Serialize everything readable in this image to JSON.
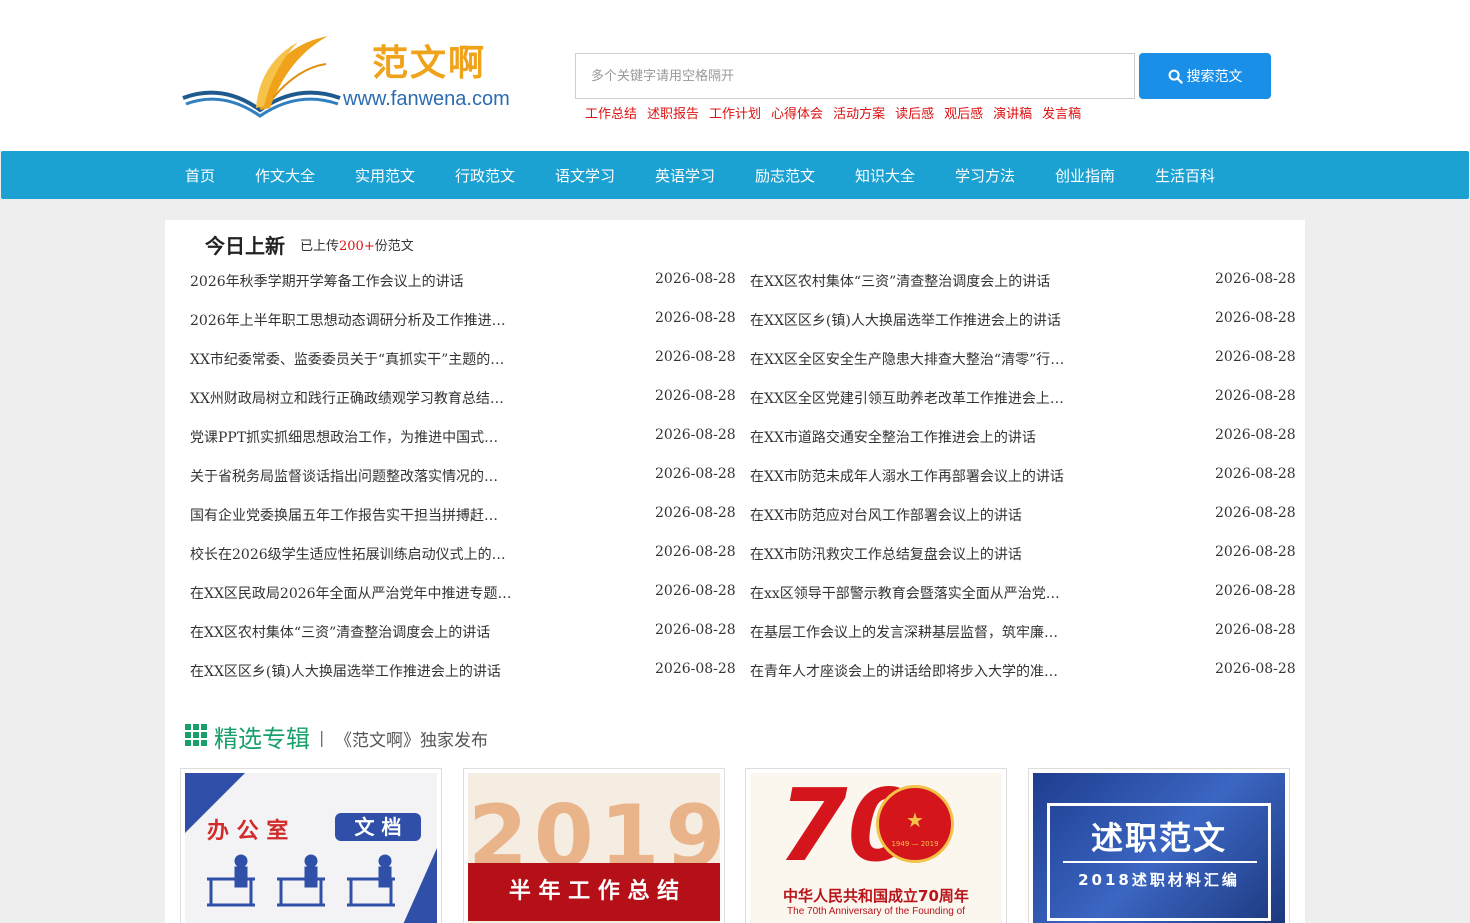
{
  "site": {
    "logo_cn": "范文啊",
    "logo_url": "www.fanwena.com"
  },
  "search": {
    "placeholder": "多个关键字请用空格隔开",
    "button_label": "搜索范文"
  },
  "hot_links": [
    "工作总结",
    "述职报告",
    "工作计划",
    "心得体会",
    "活动方案",
    "读后感",
    "观后感",
    "演讲稿",
    "发言稿"
  ],
  "nav": [
    "首页",
    "作文大全",
    "实用范文",
    "行政范文",
    "语文学习",
    "英语学习",
    "励志范文",
    "知识大全",
    "学习方法",
    "创业指南",
    "生活百科"
  ],
  "today": {
    "title": "今日上新",
    "sub_prefix": "已上传",
    "sub_count": "200+",
    "sub_suffix": "份范文",
    "left": [
      {
        "title": "2026年秋季学期开学筹备工作会议上的讲话",
        "date": "2026-08-28"
      },
      {
        "title": "2026年上半年职工思想动态调研分析及工作推进…",
        "date": "2026-08-28"
      },
      {
        "title": "XX市纪委常委、监委委员关于“真抓实干”主题的…",
        "date": "2026-08-28"
      },
      {
        "title": "XX州财政局树立和践行正确政绩观学习教育总结…",
        "date": "2026-08-28"
      },
      {
        "title": "党课PPT抓实抓细思想政治工作，为推进中国式…",
        "date": "2026-08-28"
      },
      {
        "title": "关于省税务局监督谈话指出问题整改落实情况的…",
        "date": "2026-08-28"
      },
      {
        "title": "国有企业党委换届五年工作报告实干担当拼搏赶…",
        "date": "2026-08-28"
      },
      {
        "title": "校长在2026级学生适应性拓展训练启动仪式上的…",
        "date": "2026-08-28"
      },
      {
        "title": "在XX区民政局2026年全面从严治党年中推进专题…",
        "date": "2026-08-28"
      },
      {
        "title": "在XX区农村集体“三资”清查整治调度会上的讲话",
        "date": "2026-08-28"
      },
      {
        "title": "在XX区区乡(镇)人大换届选举工作推进会上的讲话",
        "date": "2026-08-28"
      }
    ],
    "right": [
      {
        "title": "在XX区农村集体“三资”清查整治调度会上的讲话",
        "date": "2026-08-28"
      },
      {
        "title": "在XX区区乡(镇)人大换届选举工作推进会上的讲话",
        "date": "2026-08-28"
      },
      {
        "title": "在XX区全区安全生产隐患大排查大整治“清零”行…",
        "date": "2026-08-28"
      },
      {
        "title": "在XX区全区党建引领互助养老改革工作推进会上…",
        "date": "2026-08-28"
      },
      {
        "title": "在XX市道路交通安全整治工作推进会上的讲话",
        "date": "2026-08-28"
      },
      {
        "title": "在XX市防范未成年人溺水工作再部署会议上的讲话",
        "date": "2026-08-28"
      },
      {
        "title": "在XX市防范应对台风工作部署会议上的讲话",
        "date": "2026-08-28"
      },
      {
        "title": "在XX市防汛救灾工作总结复盘会议上的讲话",
        "date": "2026-08-28"
      },
      {
        "title": "在xx区领导干部警示教育会暨落实全面从严治党…",
        "date": "2026-08-28"
      },
      {
        "title": "在基层工作会议上的发言深耕基层监督，筑牢廉…",
        "date": "2026-08-28"
      },
      {
        "title": "在青年人才座谈会上的讲话给即将步入大学的准…",
        "date": "2026-08-28"
      }
    ]
  },
  "featured": {
    "title": "精选专辑",
    "separator": "|",
    "subtitle": "《范文啊》独家发布",
    "cards": [
      {
        "name": "office-docs",
        "line1": "办 公 室",
        "line2": "文 档"
      },
      {
        "name": "half-year-summary",
        "year": "2019",
        "caption": "半 年 工 作 总 结"
      },
      {
        "name": "70th-anniversary",
        "num": "70",
        "years": "1949 — 2019",
        "caption_cn": "中华人民共和国成立70周年",
        "caption_en": "The 70th Anniversary of the Founding of"
      },
      {
        "name": "report-collection",
        "title": "述职范文",
        "sub": "2018述职材料汇编"
      }
    ]
  },
  "colors": {
    "nav": "#1ba1d2",
    "search_button": "#1a8fe8",
    "hot_link": "#dd1111",
    "feature": "#17a06a",
    "logo_text": "#f0a31a",
    "logo_url": "#2b6cb0"
  },
  "icons": {
    "search_button": "search-icon",
    "feature_heading": "grid-icon"
  }
}
